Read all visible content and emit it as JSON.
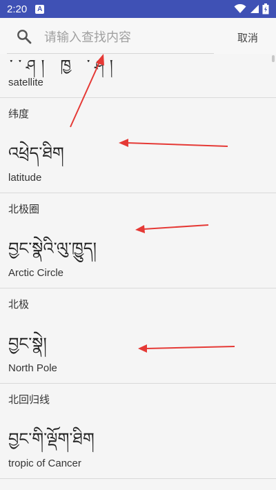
{
  "status_bar": {
    "time": "2:20",
    "notif_letter": "A"
  },
  "search": {
    "placeholder": "请输入查找内容",
    "cancel_label": "取消"
  },
  "entries": [
    {
      "zh": "",
      "tibetan": "་་ཤ།  ཁྱ  ་ཤ།",
      "english": "satellite"
    },
    {
      "zh": "纬度",
      "tibetan": "འཕྲེད་ཐིག",
      "english": "latitude"
    },
    {
      "zh": "北极圈",
      "tibetan": "བྱང་སྣེའི་ལུ་ཁྱུད།",
      "english": "Arctic Circle"
    },
    {
      "zh": "北极",
      "tibetan": "བྱང་སྣེ།",
      "english": "North Pole"
    },
    {
      "zh": "北回归线",
      "tibetan": "བྱང་གི་ལྡོག་ཐིག",
      "english": "tropic of Cancer"
    }
  ],
  "colors": {
    "status_bar": "#3f51b5",
    "arrow": "#e53935",
    "background": "#f5f5f5"
  }
}
